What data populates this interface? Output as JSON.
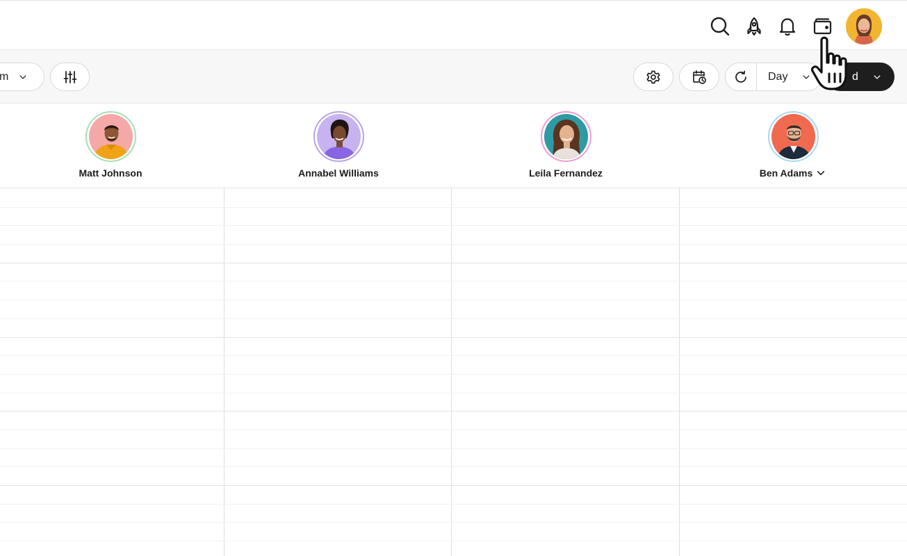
{
  "topbar": {
    "icons": [
      "search-icon",
      "rocket-icon",
      "bell-icon",
      "wallet-icon"
    ],
    "user_avatar": "current-user-avatar"
  },
  "toolbar": {
    "view_filter_label": "m",
    "filters_icon": "sliders-icon",
    "settings_icon": "gear-icon",
    "schedule_icon": "calendar-clock-icon",
    "refresh_icon": "refresh-icon",
    "range_label": "Day",
    "action_label": "d"
  },
  "people": [
    {
      "name": "Matt Johnson",
      "ring_color": "#a6dfb0",
      "bg_color": "#f4a9a8"
    },
    {
      "name": "Annabel Williams",
      "ring_color": "#b9a2e6",
      "bg_color": "#c7b3ef"
    },
    {
      "name": "Leila Fernandez",
      "ring_color": "#ec9bd6",
      "bg_color": "#2e9aa3"
    },
    {
      "name": "Ben Adams",
      "ring_color": "#a7d8f0",
      "bg_color": "#ef6a4f"
    }
  ],
  "colors": {
    "accent_dark": "#1e1e1e",
    "grid_line": "#dcdcdc"
  }
}
